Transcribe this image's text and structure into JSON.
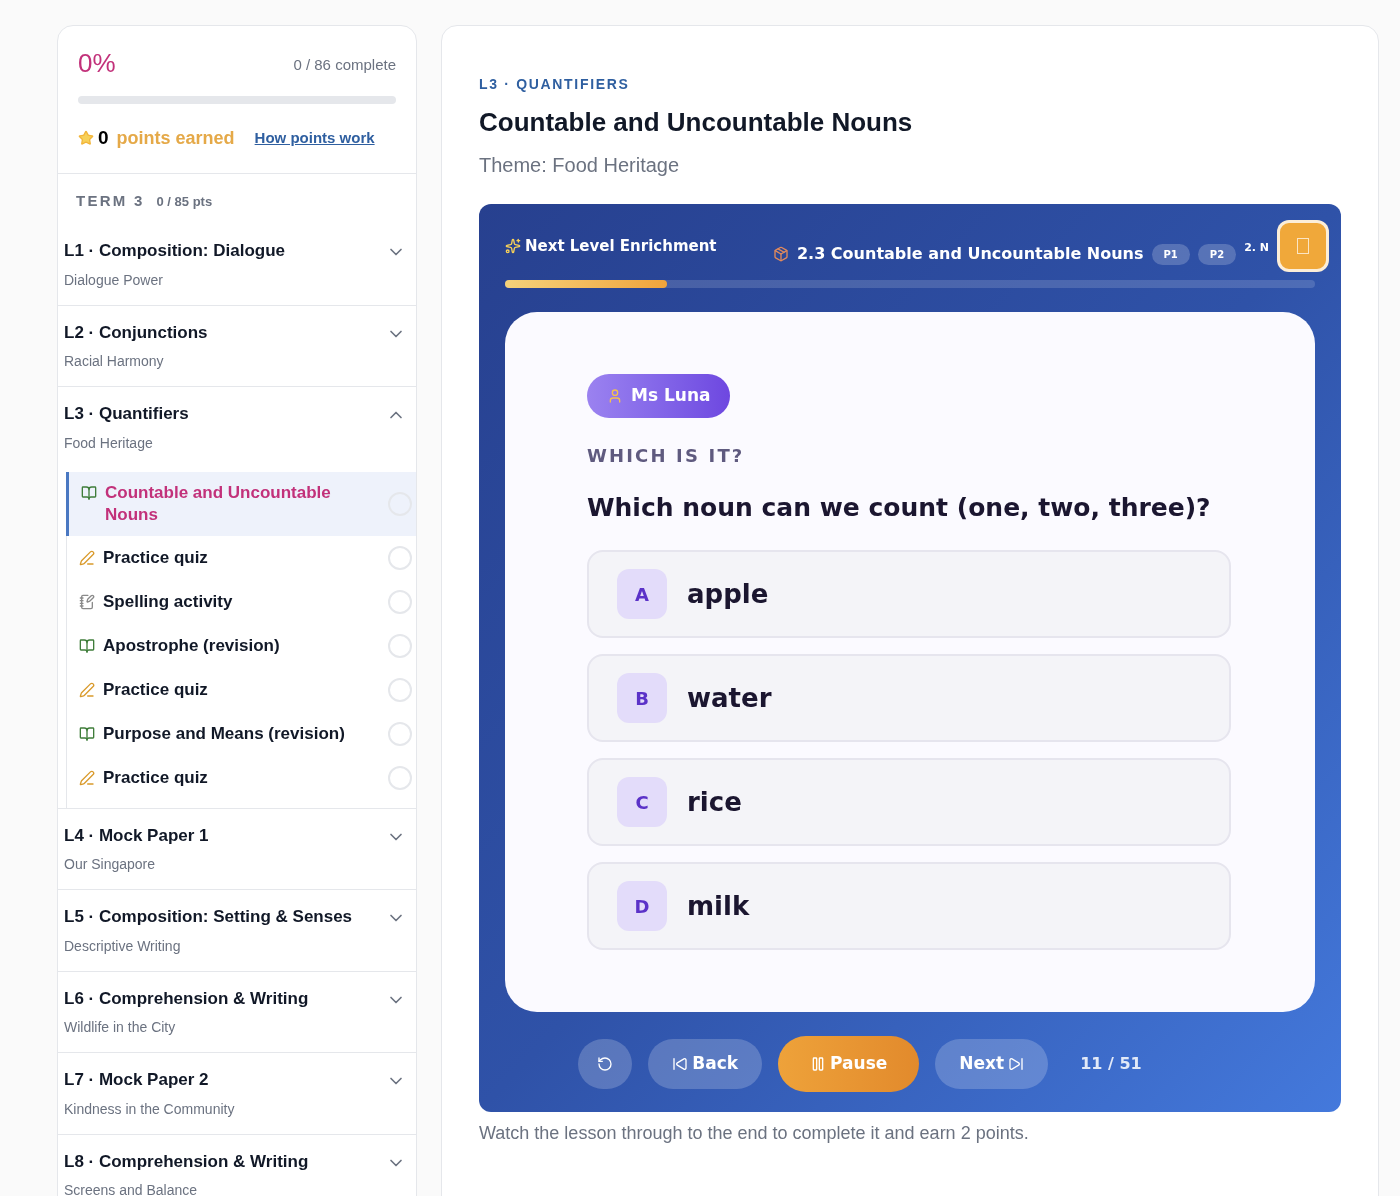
{
  "progress": {
    "percent": "0%",
    "complete": "0 / 86 complete",
    "level": 0,
    "points": "0",
    "points_label": "points earned",
    "points_link": "How points work"
  },
  "term": {
    "label": "TERM 3",
    "points": "0 / 85 pts"
  },
  "modules": [
    {
      "title": "L1 · Composition: Dialogue",
      "subtitle": "Dialogue Power",
      "expanded": false
    },
    {
      "title": "L2 · Conjunctions",
      "subtitle": "Racial Harmony",
      "expanded": false
    },
    {
      "title": "L3 · Quantifiers",
      "subtitle": "Food Heritage",
      "expanded": true,
      "children": [
        {
          "kind": "book",
          "label": "Countable and Uncountable Nouns",
          "selected": true,
          "done": false
        },
        {
          "kind": "writing",
          "label": "Practice quiz",
          "selected": false,
          "done": false
        },
        {
          "kind": "memo",
          "label": "Spelling activity",
          "selected": false,
          "done": false
        },
        {
          "kind": "book",
          "label": "Apostrophe (revision)",
          "selected": false,
          "done": false
        },
        {
          "kind": "writing",
          "label": "Practice quiz",
          "selected": false,
          "done": false
        },
        {
          "kind": "book",
          "label": "Purpose and Means (revision)",
          "selected": false,
          "done": false
        },
        {
          "kind": "writing",
          "label": "Practice quiz",
          "selected": false,
          "done": false
        }
      ]
    },
    {
      "title": "L4 · Mock Paper 1",
      "subtitle": "Our Singapore",
      "expanded": false
    },
    {
      "title": "L5 · Composition: Setting & Senses",
      "subtitle": "Descriptive Writing",
      "expanded": false
    },
    {
      "title": "L6 · Comprehension & Writing",
      "subtitle": "Wildlife in the City",
      "expanded": false
    },
    {
      "title": "L7 · Mock Paper 2",
      "subtitle": "Kindness in the Community",
      "expanded": false
    },
    {
      "title": "L8 · Comprehension & Writing",
      "subtitle": "Screens and Balance",
      "expanded": false
    }
  ],
  "lesson": {
    "eyebrow": "L3 · QUANTIFIERS",
    "title": "Countable and Uncountable Nouns",
    "theme": "Theme: Food Heritage",
    "footer": "Watch the lesson through to the end to complete it and earn 2 points."
  },
  "player": {
    "brand": "Next Level Enrichment",
    "slide_title": "2.3 Countable and Uncountable Nouns",
    "pages": [
      {
        "label": "P1",
        "selected": false
      },
      {
        "label": "P2",
        "selected": false
      }
    ],
    "corner_text": "2. N",
    "level": 0.2,
    "teacher": "Ms Luna",
    "prompt_label": "WHICH IS IT?",
    "question": "Which noun can we count (one, two, three)?",
    "options": [
      {
        "letter": "A",
        "text": "apple"
      },
      {
        "letter": "B",
        "text": "water"
      },
      {
        "letter": "C",
        "text": "rice"
      },
      {
        "letter": "D",
        "text": "milk"
      }
    ],
    "controls": [
      {
        "kind": "replay"
      },
      {
        "kind": "back",
        "label": "Back"
      },
      {
        "kind": "pause",
        "label": "Pause"
      },
      {
        "kind": "next",
        "label": "Next"
      }
    ],
    "counter": "11 / 51"
  }
}
